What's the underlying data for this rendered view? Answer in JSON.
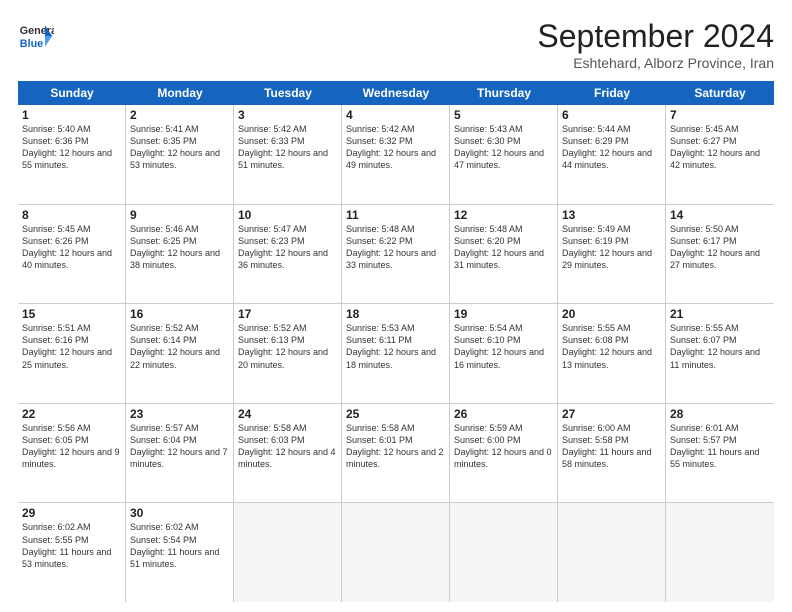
{
  "header": {
    "logo_line1": "General",
    "logo_line2": "Blue",
    "month": "September 2024",
    "location": "Eshtehard, Alborz Province, Iran"
  },
  "weekdays": [
    "Sunday",
    "Monday",
    "Tuesday",
    "Wednesday",
    "Thursday",
    "Friday",
    "Saturday"
  ],
  "weeks": [
    [
      {
        "day": "1",
        "sunrise": "5:40 AM",
        "sunset": "6:36 PM",
        "daylight": "12 hours and 55 minutes."
      },
      {
        "day": "2",
        "sunrise": "5:41 AM",
        "sunset": "6:35 PM",
        "daylight": "12 hours and 53 minutes."
      },
      {
        "day": "3",
        "sunrise": "5:42 AM",
        "sunset": "6:33 PM",
        "daylight": "12 hours and 51 minutes."
      },
      {
        "day": "4",
        "sunrise": "5:42 AM",
        "sunset": "6:32 PM",
        "daylight": "12 hours and 49 minutes."
      },
      {
        "day": "5",
        "sunrise": "5:43 AM",
        "sunset": "6:30 PM",
        "daylight": "12 hours and 47 minutes."
      },
      {
        "day": "6",
        "sunrise": "5:44 AM",
        "sunset": "6:29 PM",
        "daylight": "12 hours and 44 minutes."
      },
      {
        "day": "7",
        "sunrise": "5:45 AM",
        "sunset": "6:27 PM",
        "daylight": "12 hours and 42 minutes."
      }
    ],
    [
      {
        "day": "8",
        "sunrise": "5:45 AM",
        "sunset": "6:26 PM",
        "daylight": "12 hours and 40 minutes."
      },
      {
        "day": "9",
        "sunrise": "5:46 AM",
        "sunset": "6:25 PM",
        "daylight": "12 hours and 38 minutes."
      },
      {
        "day": "10",
        "sunrise": "5:47 AM",
        "sunset": "6:23 PM",
        "daylight": "12 hours and 36 minutes."
      },
      {
        "day": "11",
        "sunrise": "5:48 AM",
        "sunset": "6:22 PM",
        "daylight": "12 hours and 33 minutes."
      },
      {
        "day": "12",
        "sunrise": "5:48 AM",
        "sunset": "6:20 PM",
        "daylight": "12 hours and 31 minutes."
      },
      {
        "day": "13",
        "sunrise": "5:49 AM",
        "sunset": "6:19 PM",
        "daylight": "12 hours and 29 minutes."
      },
      {
        "day": "14",
        "sunrise": "5:50 AM",
        "sunset": "6:17 PM",
        "daylight": "12 hours and 27 minutes."
      }
    ],
    [
      {
        "day": "15",
        "sunrise": "5:51 AM",
        "sunset": "6:16 PM",
        "daylight": "12 hours and 25 minutes."
      },
      {
        "day": "16",
        "sunrise": "5:52 AM",
        "sunset": "6:14 PM",
        "daylight": "12 hours and 22 minutes."
      },
      {
        "day": "17",
        "sunrise": "5:52 AM",
        "sunset": "6:13 PM",
        "daylight": "12 hours and 20 minutes."
      },
      {
        "day": "18",
        "sunrise": "5:53 AM",
        "sunset": "6:11 PM",
        "daylight": "12 hours and 18 minutes."
      },
      {
        "day": "19",
        "sunrise": "5:54 AM",
        "sunset": "6:10 PM",
        "daylight": "12 hours and 16 minutes."
      },
      {
        "day": "20",
        "sunrise": "5:55 AM",
        "sunset": "6:08 PM",
        "daylight": "12 hours and 13 minutes."
      },
      {
        "day": "21",
        "sunrise": "5:55 AM",
        "sunset": "6:07 PM",
        "daylight": "12 hours and 11 minutes."
      }
    ],
    [
      {
        "day": "22",
        "sunrise": "5:56 AM",
        "sunset": "6:05 PM",
        "daylight": "12 hours and 9 minutes."
      },
      {
        "day": "23",
        "sunrise": "5:57 AM",
        "sunset": "6:04 PM",
        "daylight": "12 hours and 7 minutes."
      },
      {
        "day": "24",
        "sunrise": "5:58 AM",
        "sunset": "6:03 PM",
        "daylight": "12 hours and 4 minutes."
      },
      {
        "day": "25",
        "sunrise": "5:58 AM",
        "sunset": "6:01 PM",
        "daylight": "12 hours and 2 minutes."
      },
      {
        "day": "26",
        "sunrise": "5:59 AM",
        "sunset": "6:00 PM",
        "daylight": "12 hours and 0 minutes."
      },
      {
        "day": "27",
        "sunrise": "6:00 AM",
        "sunset": "5:58 PM",
        "daylight": "11 hours and 58 minutes."
      },
      {
        "day": "28",
        "sunrise": "6:01 AM",
        "sunset": "5:57 PM",
        "daylight": "11 hours and 55 minutes."
      }
    ],
    [
      {
        "day": "29",
        "sunrise": "6:02 AM",
        "sunset": "5:55 PM",
        "daylight": "11 hours and 53 minutes."
      },
      {
        "day": "30",
        "sunrise": "6:02 AM",
        "sunset": "5:54 PM",
        "daylight": "11 hours and 51 minutes."
      },
      {
        "day": "",
        "sunrise": "",
        "sunset": "",
        "daylight": ""
      },
      {
        "day": "",
        "sunrise": "",
        "sunset": "",
        "daylight": ""
      },
      {
        "day": "",
        "sunrise": "",
        "sunset": "",
        "daylight": ""
      },
      {
        "day": "",
        "sunrise": "",
        "sunset": "",
        "daylight": ""
      },
      {
        "day": "",
        "sunrise": "",
        "sunset": "",
        "daylight": ""
      }
    ]
  ]
}
